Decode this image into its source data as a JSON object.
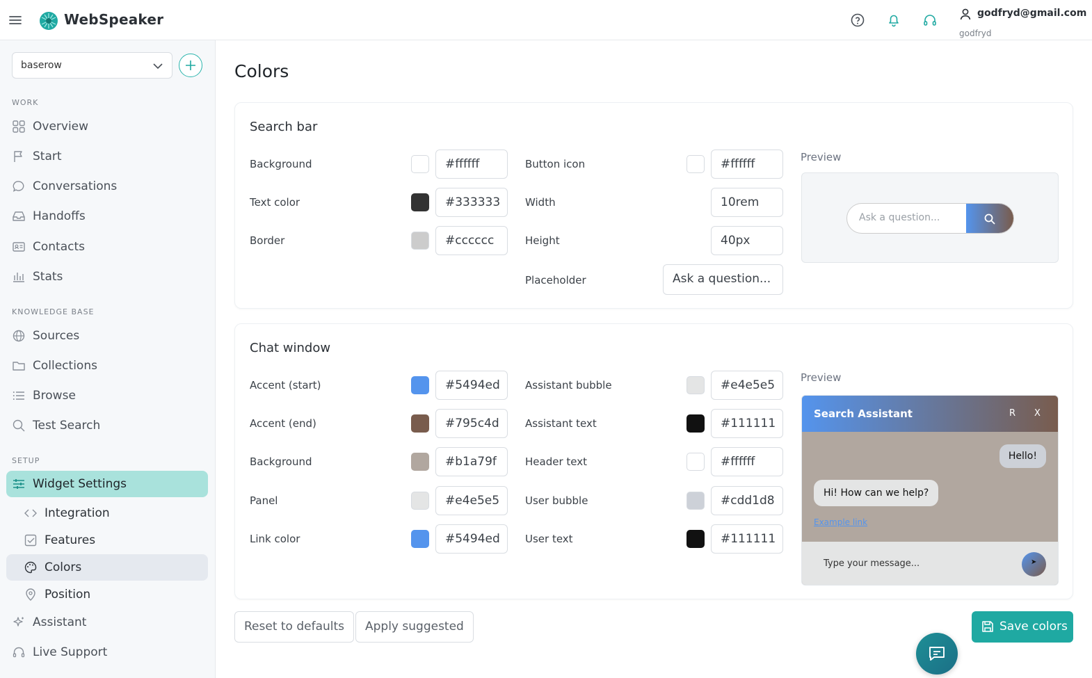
{
  "app": {
    "brand": "WebSpeaker"
  },
  "user": {
    "email": "godfryd@gmail.com",
    "name": "godfryd"
  },
  "workspace": {
    "selected": "baserow"
  },
  "sidebar": {
    "work_label": "WORK",
    "kb_label": "KNOWLEDGE BASE",
    "setup_label": "SETUP",
    "work": [
      {
        "label": "Overview",
        "icon": "grid-icon"
      },
      {
        "label": "Start",
        "icon": "flag-icon"
      },
      {
        "label": "Conversations",
        "icon": "chat-icon"
      },
      {
        "label": "Handoffs",
        "icon": "inbox-icon"
      },
      {
        "label": "Contacts",
        "icon": "contact-card-icon"
      },
      {
        "label": "Stats",
        "icon": "bar-chart-icon"
      }
    ],
    "kb": [
      {
        "label": "Sources",
        "icon": "globe-icon"
      },
      {
        "label": "Collections",
        "icon": "folder-icon"
      },
      {
        "label": "Browse",
        "icon": "list-icon"
      },
      {
        "label": "Test Search",
        "icon": "search-icon"
      }
    ],
    "setup": {
      "widget_settings": "Widget Settings",
      "sub": [
        {
          "label": "Integration",
          "icon": "code-icon"
        },
        {
          "label": "Features",
          "icon": "checkbox-icon"
        },
        {
          "label": "Colors",
          "icon": "palette-icon"
        },
        {
          "label": "Position",
          "icon": "pin-icon"
        }
      ],
      "assistant": "Assistant",
      "live_support": "Live Support"
    }
  },
  "page": {
    "title": "Colors"
  },
  "search_bar": {
    "title": "Search bar",
    "background": {
      "label": "Background",
      "value": "#ffffff"
    },
    "text_color": {
      "label": "Text color",
      "value": "#333333"
    },
    "border": {
      "label": "Border",
      "value": "#cccccc"
    },
    "button_icon": {
      "label": "Button icon",
      "value": "#ffffff"
    },
    "width": {
      "label": "Width",
      "value": "10rem"
    },
    "height": {
      "label": "Height",
      "value": "40px"
    },
    "placeholder": {
      "label": "Placeholder",
      "value": "Ask a question..."
    },
    "preview_label": "Preview",
    "preview_placeholder": "Ask a question..."
  },
  "chat_window": {
    "title": "Chat window",
    "accent_start": {
      "label": "Accent (start)",
      "value": "#5494ed"
    },
    "accent_end": {
      "label": "Accent (end)",
      "value": "#795c4d"
    },
    "background": {
      "label": "Background",
      "value": "#b1a79f"
    },
    "panel": {
      "label": "Panel",
      "value": "#e4e5e5"
    },
    "link_color": {
      "label": "Link color",
      "value": "#5494ed"
    },
    "assistant_bubble": {
      "label": "Assistant bubble",
      "value": "#e4e5e5"
    },
    "assistant_text": {
      "label": "Assistant text",
      "value": "#111111"
    },
    "header_text": {
      "label": "Header text",
      "value": "#ffffff"
    },
    "user_bubble": {
      "label": "User bubble",
      "value": "#cdd1d8"
    },
    "user_text": {
      "label": "User text",
      "value": "#111111"
    },
    "preview_label": "Preview",
    "preview": {
      "title": "Search Assistant",
      "r_label": "R",
      "x_label": "X",
      "user_msg": "Hello!",
      "assistant_msg": "Hi! How can we help?",
      "link": "Example link",
      "input_placeholder": "Type your message...",
      "send": "➤"
    }
  },
  "actions": {
    "reset": "Reset to defaults",
    "apply": "Apply suggested",
    "save": "Save colors"
  },
  "colors": {
    "accent": "#1fa9a2",
    "active_nav": "#a9e2dc"
  }
}
